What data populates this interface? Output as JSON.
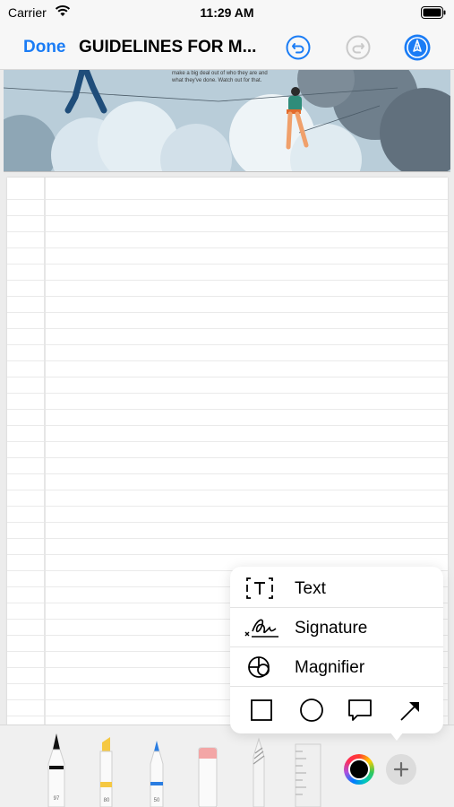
{
  "status_bar": {
    "carrier": "Carrier",
    "time": "11:29 AM"
  },
  "nav": {
    "done_label": "Done",
    "title": "GUIDELINES FOR M..."
  },
  "document": {
    "banner_text": "make a big deal out of who they are and what they've done. Watch out for that."
  },
  "markup_menu": {
    "items": [
      {
        "label": "Text",
        "icon": "text-box-icon"
      },
      {
        "label": "Signature",
        "icon": "signature-icon"
      },
      {
        "label": "Magnifier",
        "icon": "magnifier-icon"
      }
    ],
    "shapes": [
      "square-shape-icon",
      "circle-shape-icon",
      "speech-bubble-icon",
      "arrow-icon"
    ]
  },
  "toolbar": {
    "tools": [
      {
        "name": "pen",
        "width_label": "97",
        "color": "#111111"
      },
      {
        "name": "highlighter",
        "width_label": "80",
        "color": "#f5c842"
      },
      {
        "name": "pencil",
        "width_label": "50",
        "color": "#2a7de1"
      },
      {
        "name": "eraser"
      },
      {
        "name": "lasso"
      },
      {
        "name": "ruler"
      }
    ],
    "selected_color": "#000000"
  }
}
